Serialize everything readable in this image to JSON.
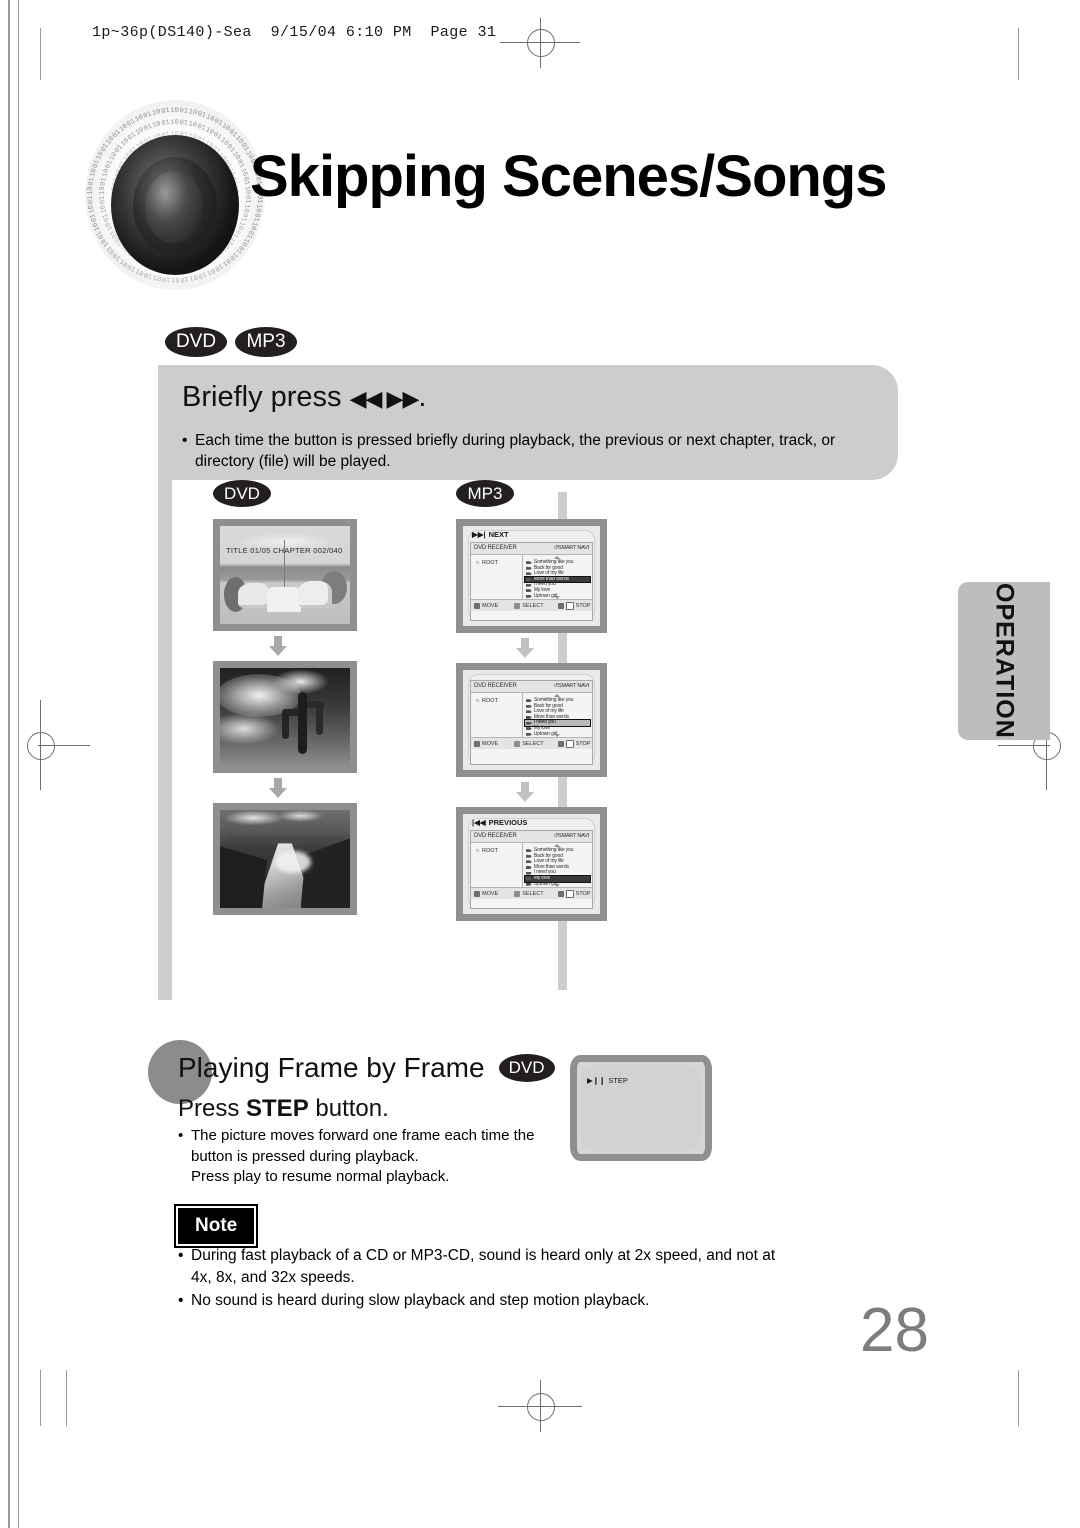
{
  "print_header": "1p~36p(DS140)-Sea  9/15/04 6:10 PM  Page 31",
  "title": "Skipping Scenes/Songs",
  "side_tab": "OPERATION",
  "page_number": "28",
  "media_chips": [
    {
      "label": "DVD"
    },
    {
      "label": "MP3"
    }
  ],
  "instruction_panel": {
    "heading_prefix": "Briefly press",
    "heading_glyphs": "◀◀ ▶▶",
    "heading_suffix": ".",
    "bullet": "Each time the button is pressed briefly during playback, the previous or next chapter, track, or directory (file) will be played."
  },
  "diagram": {
    "dvd_column": {
      "chip": "DVD",
      "screens": [
        {
          "osd": "TITLE  01/05  CHAPTER  002/040",
          "scene": "patio-umbrella"
        },
        {
          "osd": "",
          "scene": "cactus-sky"
        },
        {
          "osd": "TITLE  01/05  CHAPTER  004/040",
          "scene": "river-canyon"
        }
      ]
    },
    "mp3_column": {
      "chip": "MP3",
      "screens": [
        {
          "header": "NEXT",
          "header_icon": "skip-forward-icon",
          "nav_title_left": "DVD RECEIVER",
          "nav_title_right": "SMART NAVI",
          "folder": "ROOT",
          "songs": [
            "Something like you",
            "Back for good",
            "Love of my life",
            "More than words",
            "I need you",
            "My love",
            "Uptown girl"
          ],
          "selected_index": 3,
          "buttons": [
            "MOVE",
            "SELECT",
            "STOP"
          ]
        },
        {
          "header": "",
          "header_icon": "",
          "nav_title_left": "DVD RECEIVER",
          "nav_title_right": "SMART NAVI",
          "folder": "ROOT",
          "songs": [
            "Something like you",
            "Back for good",
            "Love of my life",
            "More than words",
            "I need you",
            "My love",
            "Uptown girl"
          ],
          "selected_index": 4,
          "buttons": [
            "MOVE",
            "SELECT",
            "STOP"
          ]
        },
        {
          "header": "PREVIOUS",
          "header_icon": "skip-back-icon",
          "nav_title_left": "DVD RECEIVER",
          "nav_title_right": "SMART NAVI",
          "folder": "ROOT",
          "songs": [
            "Something like you",
            "Back for good",
            "Love of my life",
            "More than words",
            "I need you",
            "My love",
            "Uptown girl"
          ],
          "selected_index": 5,
          "buttons": [
            "MOVE",
            "SELECT",
            "STOP"
          ]
        }
      ]
    }
  },
  "frame_by_frame": {
    "heading": "Playing Frame by Frame",
    "chip": "DVD",
    "subheading_pre": "Press ",
    "subheading_bold": "STEP",
    "subheading_post": " button.",
    "bullet_line1": "The picture moves forward one frame each time the",
    "bullet_line2": "button is pressed during playback.",
    "bullet_line3": "Press play to resume normal playback.",
    "screen_label": "STEP",
    "screen_icon": "play-pause-icon"
  },
  "note": {
    "badge": "Note",
    "items": [
      "During fast playback of a CD or MP3-CD, sound is heard only at 2x speed, and not at 4x, 8x, and 32x speeds.",
      "No sound is heard during slow playback and step motion playback."
    ]
  },
  "colors": {
    "panel_gray": "#cdcdcd",
    "chip_black": "#231f20",
    "tab_gray": "#bdbdbd",
    "page_number_gray": "#7d7d7d"
  }
}
